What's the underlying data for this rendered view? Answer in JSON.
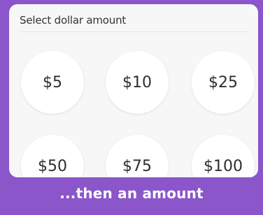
{
  "header": {
    "title": "Select dollar amount"
  },
  "amounts": [
    {
      "label": "$5"
    },
    {
      "label": "$10"
    },
    {
      "label": "$25"
    },
    {
      "label": "$50"
    },
    {
      "label": "$75"
    },
    {
      "label": "$100"
    }
  ],
  "caption": {
    "text": "...then an amount"
  },
  "colors": {
    "accent": "#8a56c9",
    "panel_background": "#f7f7f7",
    "button_background": "#ffffff",
    "text": "#2e2e2e"
  }
}
